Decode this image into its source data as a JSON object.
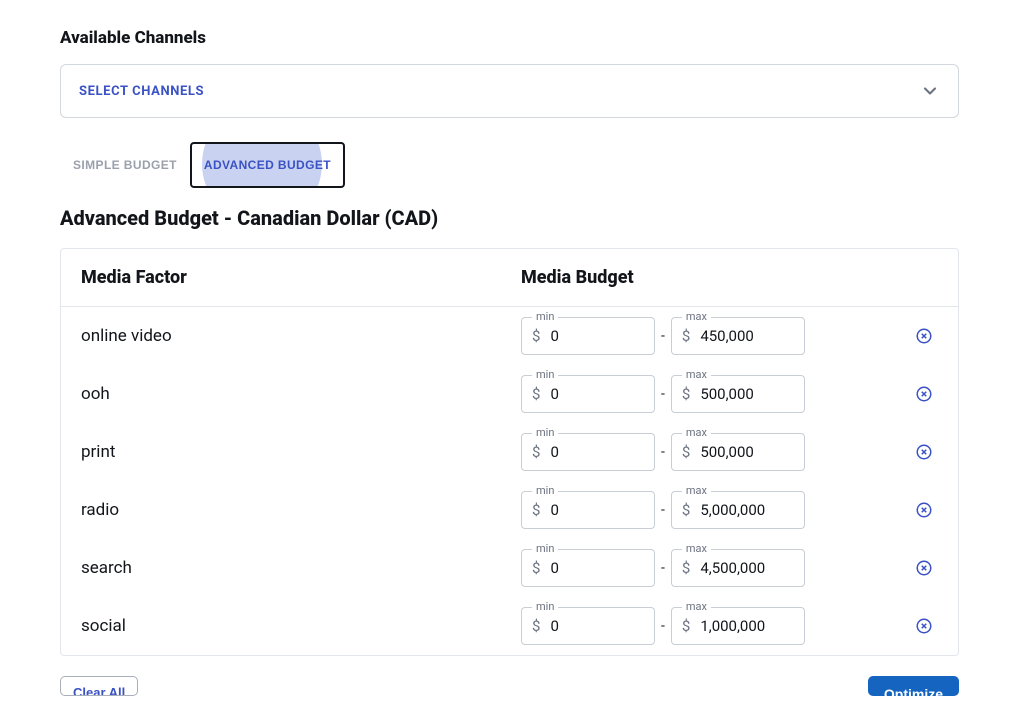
{
  "header": {
    "available_channels_title": "Available Channels",
    "select_channels_label": "SELECT CHANNELS"
  },
  "tabs": {
    "simple": "SIMPLE BUDGET",
    "advanced": "ADVANCED BUDGET"
  },
  "budget": {
    "title": "Advanced Budget - Canadian Dollar (CAD)",
    "col_factor": "Media Factor",
    "col_budget": "Media Budget",
    "min_label": "min",
    "max_label": "max",
    "rows": [
      {
        "factor": "online video",
        "min": "0",
        "max": "450,000"
      },
      {
        "factor": "ooh",
        "min": "0",
        "max": "500,000"
      },
      {
        "factor": "print",
        "min": "0",
        "max": "500,000"
      },
      {
        "factor": "radio",
        "min": "0",
        "max": "5,000,000"
      },
      {
        "factor": "search",
        "min": "0",
        "max": "4,500,000"
      },
      {
        "factor": "social",
        "min": "0",
        "max": "1,000,000"
      }
    ]
  },
  "footer": {
    "clear_all": "Clear All",
    "optimize": "Optimize"
  },
  "icons": {
    "chevron_down": "chevron-down-icon",
    "remove": "close-circle-icon",
    "dollar": "$"
  }
}
